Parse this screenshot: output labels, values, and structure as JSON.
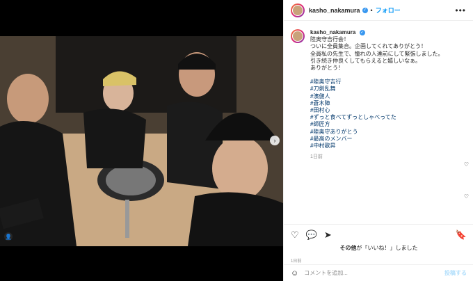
{
  "header": {
    "username": "kasho_nakamura",
    "separator": "•",
    "follow_label": "フォロー",
    "more_label": "•••"
  },
  "caption": {
    "username": "kasho_nakamura",
    "text": "陸奥守吉行会！\nついに全員集合。企画してくれてありがとう！\n全員私の先生で、憧れの人達前にして緊張しました。\n引き続き仲良くしてもらえると嬉しいなぁ。\nありがとう！",
    "hashtags": [
      "#陸奥守吉行",
      "#刀剣乱舞",
      "#濱健人",
      "#蒼木陣",
      "#田村心",
      "#ずっと食べてずっとしゃべってた",
      "#師匠方",
      "#陸奥守ありがとう",
      "#最高のメンバー",
      "#中村歌昇"
    ],
    "time": "1日前"
  },
  "icons": {
    "like": "heart-icon",
    "comment": "comment-icon",
    "share": "share-icon",
    "save": "bookmark-icon",
    "emoji": "emoji-icon",
    "next": "chevron-right-icon",
    "tag": "user-tag-icon"
  },
  "likes": {
    "name": "その他",
    "text": "が「いいね！」しました"
  },
  "post_time": "1日前",
  "comment": {
    "placeholder": "コメントを追加...",
    "post_label": "投稿する"
  },
  "colors": {
    "accent": "#0095f6",
    "verified": "#3897f0",
    "hashtag": "#00376b"
  }
}
